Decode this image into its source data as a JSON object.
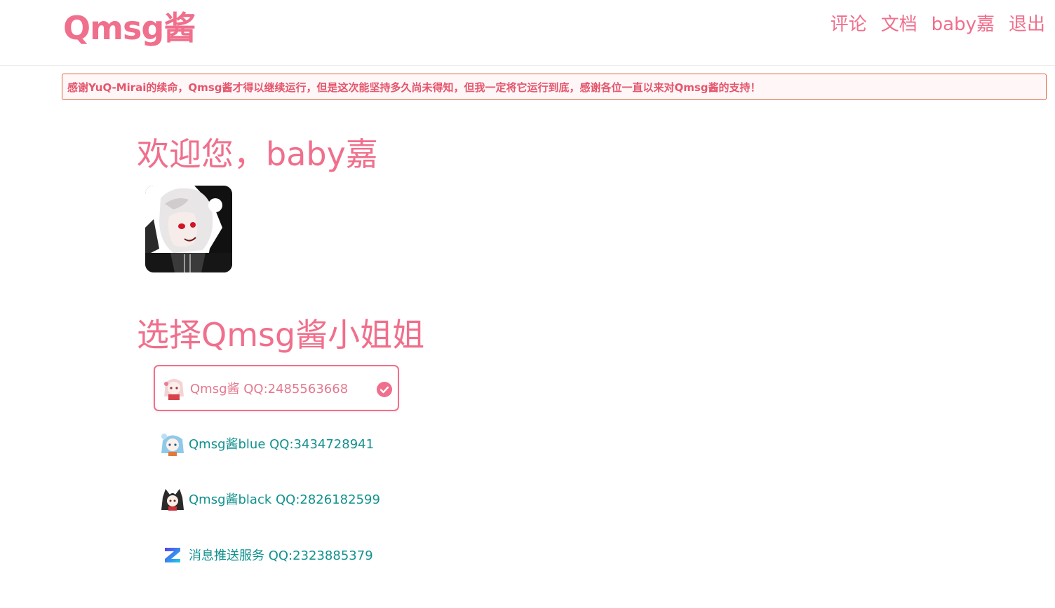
{
  "header": {
    "logo": "Qmsg酱",
    "nav": [
      "评论",
      "文档",
      "baby嘉",
      "退出"
    ]
  },
  "notice": "感谢YuQ-Mirai的续命，Qmsg酱才得以继续运行，但是这次能坚持多久尚未得知，但我一定将它运行到底，感谢各位一直以来对Qmsg酱的支持！",
  "welcome": "欢迎您，baby嘉",
  "section_title": "选择Qmsg酱小姐姐",
  "bots": [
    {
      "label": "Qmsg酱 QQ:2485563668",
      "selected": true
    },
    {
      "label": "Qmsg酱blue QQ:3434728941",
      "selected": false
    },
    {
      "label": "Qmsg酱black QQ:2826182599",
      "selected": false
    },
    {
      "label": "消息推送服务 QQ:2323885379",
      "selected": false
    }
  ],
  "colors": {
    "accent": "#f06f8c",
    "notice_border": "#d9673e",
    "notice_text": "#e4566c",
    "bot_text": "#11918e"
  }
}
